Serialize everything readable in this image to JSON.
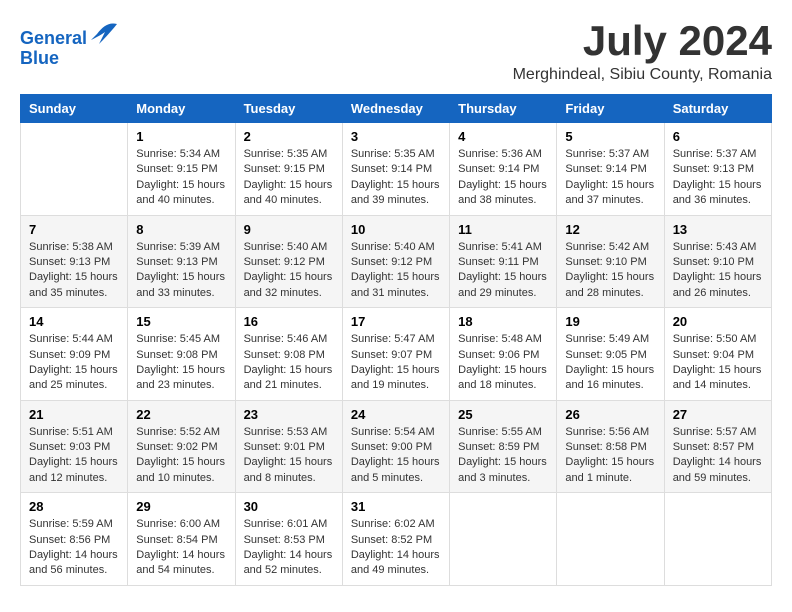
{
  "header": {
    "logo_line1": "General",
    "logo_line2": "Blue",
    "title": "July 2024",
    "subtitle": "Merghindeal, Sibiu County, Romania"
  },
  "calendar": {
    "days_of_week": [
      "Sunday",
      "Monday",
      "Tuesday",
      "Wednesday",
      "Thursday",
      "Friday",
      "Saturday"
    ],
    "weeks": [
      [
        {
          "date": "",
          "content": ""
        },
        {
          "date": "1",
          "content": "Sunrise: 5:34 AM\nSunset: 9:15 PM\nDaylight: 15 hours\nand 40 minutes."
        },
        {
          "date": "2",
          "content": "Sunrise: 5:35 AM\nSunset: 9:15 PM\nDaylight: 15 hours\nand 40 minutes."
        },
        {
          "date": "3",
          "content": "Sunrise: 5:35 AM\nSunset: 9:14 PM\nDaylight: 15 hours\nand 39 minutes."
        },
        {
          "date": "4",
          "content": "Sunrise: 5:36 AM\nSunset: 9:14 PM\nDaylight: 15 hours\nand 38 minutes."
        },
        {
          "date": "5",
          "content": "Sunrise: 5:37 AM\nSunset: 9:14 PM\nDaylight: 15 hours\nand 37 minutes."
        },
        {
          "date": "6",
          "content": "Sunrise: 5:37 AM\nSunset: 9:13 PM\nDaylight: 15 hours\nand 36 minutes."
        }
      ],
      [
        {
          "date": "7",
          "content": "Sunrise: 5:38 AM\nSunset: 9:13 PM\nDaylight: 15 hours\nand 35 minutes."
        },
        {
          "date": "8",
          "content": "Sunrise: 5:39 AM\nSunset: 9:13 PM\nDaylight: 15 hours\nand 33 minutes."
        },
        {
          "date": "9",
          "content": "Sunrise: 5:40 AM\nSunset: 9:12 PM\nDaylight: 15 hours\nand 32 minutes."
        },
        {
          "date": "10",
          "content": "Sunrise: 5:40 AM\nSunset: 9:12 PM\nDaylight: 15 hours\nand 31 minutes."
        },
        {
          "date": "11",
          "content": "Sunrise: 5:41 AM\nSunset: 9:11 PM\nDaylight: 15 hours\nand 29 minutes."
        },
        {
          "date": "12",
          "content": "Sunrise: 5:42 AM\nSunset: 9:10 PM\nDaylight: 15 hours\nand 28 minutes."
        },
        {
          "date": "13",
          "content": "Sunrise: 5:43 AM\nSunset: 9:10 PM\nDaylight: 15 hours\nand 26 minutes."
        }
      ],
      [
        {
          "date": "14",
          "content": "Sunrise: 5:44 AM\nSunset: 9:09 PM\nDaylight: 15 hours\nand 25 minutes."
        },
        {
          "date": "15",
          "content": "Sunrise: 5:45 AM\nSunset: 9:08 PM\nDaylight: 15 hours\nand 23 minutes."
        },
        {
          "date": "16",
          "content": "Sunrise: 5:46 AM\nSunset: 9:08 PM\nDaylight: 15 hours\nand 21 minutes."
        },
        {
          "date": "17",
          "content": "Sunrise: 5:47 AM\nSunset: 9:07 PM\nDaylight: 15 hours\nand 19 minutes."
        },
        {
          "date": "18",
          "content": "Sunrise: 5:48 AM\nSunset: 9:06 PM\nDaylight: 15 hours\nand 18 minutes."
        },
        {
          "date": "19",
          "content": "Sunrise: 5:49 AM\nSunset: 9:05 PM\nDaylight: 15 hours\nand 16 minutes."
        },
        {
          "date": "20",
          "content": "Sunrise: 5:50 AM\nSunset: 9:04 PM\nDaylight: 15 hours\nand 14 minutes."
        }
      ],
      [
        {
          "date": "21",
          "content": "Sunrise: 5:51 AM\nSunset: 9:03 PM\nDaylight: 15 hours\nand 12 minutes."
        },
        {
          "date": "22",
          "content": "Sunrise: 5:52 AM\nSunset: 9:02 PM\nDaylight: 15 hours\nand 10 minutes."
        },
        {
          "date": "23",
          "content": "Sunrise: 5:53 AM\nSunset: 9:01 PM\nDaylight: 15 hours\nand 8 minutes."
        },
        {
          "date": "24",
          "content": "Sunrise: 5:54 AM\nSunset: 9:00 PM\nDaylight: 15 hours\nand 5 minutes."
        },
        {
          "date": "25",
          "content": "Sunrise: 5:55 AM\nSunset: 8:59 PM\nDaylight: 15 hours\nand 3 minutes."
        },
        {
          "date": "26",
          "content": "Sunrise: 5:56 AM\nSunset: 8:58 PM\nDaylight: 15 hours\nand 1 minute."
        },
        {
          "date": "27",
          "content": "Sunrise: 5:57 AM\nSunset: 8:57 PM\nDaylight: 14 hours\nand 59 minutes."
        }
      ],
      [
        {
          "date": "28",
          "content": "Sunrise: 5:59 AM\nSunset: 8:56 PM\nDaylight: 14 hours\nand 56 minutes."
        },
        {
          "date": "29",
          "content": "Sunrise: 6:00 AM\nSunset: 8:54 PM\nDaylight: 14 hours\nand 54 minutes."
        },
        {
          "date": "30",
          "content": "Sunrise: 6:01 AM\nSunset: 8:53 PM\nDaylight: 14 hours\nand 52 minutes."
        },
        {
          "date": "31",
          "content": "Sunrise: 6:02 AM\nSunset: 8:52 PM\nDaylight: 14 hours\nand 49 minutes."
        },
        {
          "date": "",
          "content": ""
        },
        {
          "date": "",
          "content": ""
        },
        {
          "date": "",
          "content": ""
        }
      ]
    ]
  }
}
